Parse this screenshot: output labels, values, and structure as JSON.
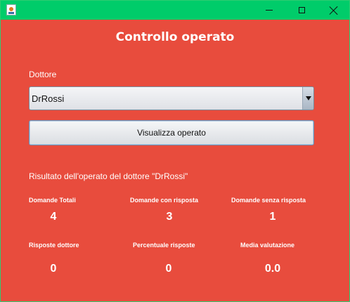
{
  "window": {
    "title": "",
    "icon": "java-coffee-icon",
    "titlebar_color": "#00cc6a",
    "background_color": "#e84c3d"
  },
  "heading": "Controllo operato",
  "doctor_field": {
    "label": "Dottore",
    "selected": "DrRossi"
  },
  "view_button": "Visualizza operato",
  "result_label": "Risultato dell'operato del dottore \"DrRossi\"",
  "stats": [
    {
      "title": "Domande Totali",
      "value": "4"
    },
    {
      "title": "Domande con risposta",
      "value": "3"
    },
    {
      "title": "Domande senza risposta",
      "value": "1"
    },
    {
      "title": "Risposte dottore",
      "value": "0"
    },
    {
      "title": "Percentuale risposte",
      "value": "0"
    },
    {
      "title": "Media valutazione",
      "value": "0.0"
    }
  ]
}
